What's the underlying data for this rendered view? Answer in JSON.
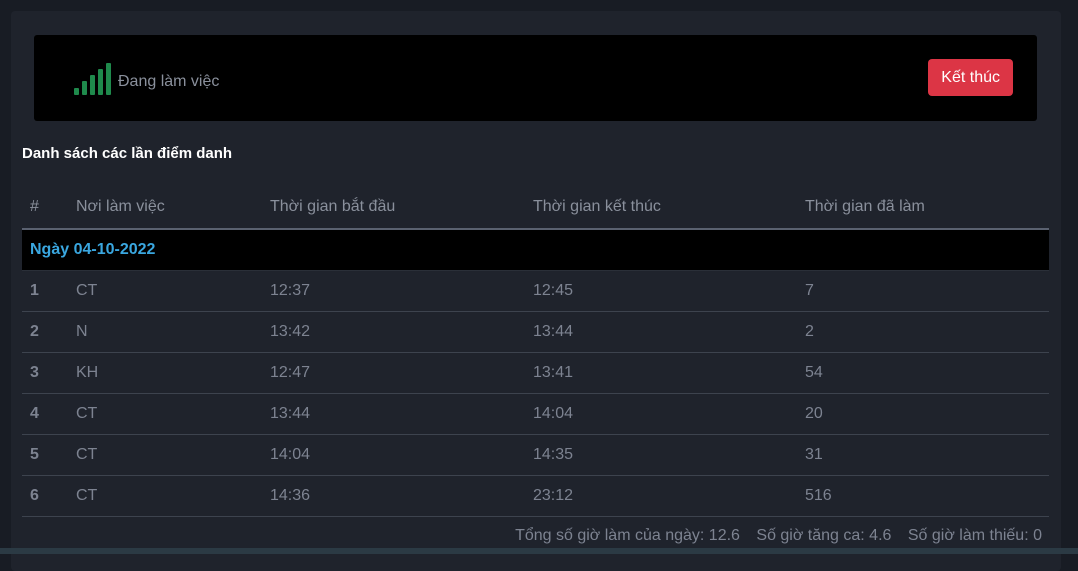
{
  "status": {
    "label": "Đang làm việc",
    "end_button_label": "Kết thúc",
    "signal_bars": 5,
    "accent_color": "#1f8a4c",
    "end_button_color": "#dc3545"
  },
  "section_title": "Danh sách các lần điểm danh",
  "table": {
    "headers": [
      "#",
      "Nơi làm việc",
      "Thời gian bắt đầu",
      "Thời gian kết thúc",
      "Thời gian đã làm"
    ],
    "date_group": "Ngày 04-10-2022",
    "rows": [
      {
        "index": "1",
        "place": "CT",
        "start": "12:37",
        "end": "12:45",
        "duration": "7"
      },
      {
        "index": "2",
        "place": "N",
        "start": "13:42",
        "end": "13:44",
        "duration": "2"
      },
      {
        "index": "3",
        "place": "KH",
        "start": "12:47",
        "end": "13:41",
        "duration": "54"
      },
      {
        "index": "4",
        "place": "CT",
        "start": "13:44",
        "end": "14:04",
        "duration": "20"
      },
      {
        "index": "5",
        "place": "CT",
        "start": "14:04",
        "end": "14:35",
        "duration": "31"
      },
      {
        "index": "6",
        "place": "CT",
        "start": "14:36",
        "end": "23:12",
        "duration": "516"
      }
    ]
  },
  "summary": {
    "total_hours": "Tổng số giờ làm của ngày: 12.6",
    "overtime": "Số giờ tăng ca: 4.6",
    "missing": "Số giờ làm thiếu: 0"
  }
}
